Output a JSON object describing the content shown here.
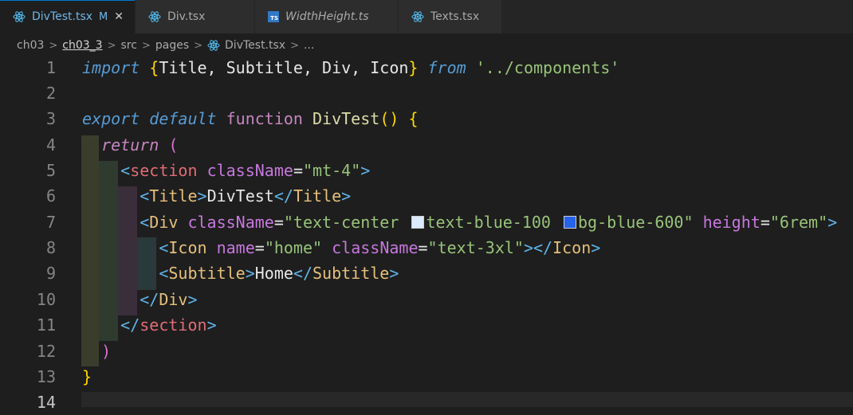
{
  "tabs": [
    {
      "label": "DivTest.tsx",
      "badge": "M",
      "close": "✕",
      "icon": "react-icon",
      "active": true
    },
    {
      "label": "Div.tsx",
      "icon": "react-icon"
    },
    {
      "label": "WidthHeight.ts",
      "icon": "ts-icon",
      "icon_text": "TS"
    },
    {
      "label": "Texts.tsx",
      "icon": "react-icon"
    }
  ],
  "breadcrumb": {
    "items": [
      "ch03",
      "ch03_3",
      "src",
      "pages",
      "DivTest.tsx",
      "..."
    ],
    "separator": ">"
  },
  "editor": {
    "line_numbers": [
      "1",
      "2",
      "3",
      "4",
      "5",
      "6",
      "7",
      "8",
      "9",
      "10",
      "11",
      "12",
      "13",
      "14"
    ],
    "tokens": {
      "import": "import",
      "from": "from",
      "lbrace": "{",
      "rbrace": "}",
      "import_names": "Title, Subtitle, Div, Icon",
      "module": "'../components'",
      "export": "export",
      "default": "default",
      "function": "function",
      "fn_name": "DivTest",
      "parens": "()",
      "return": "return",
      "lparen": "(",
      "rparen": ")",
      "lt": "<",
      "gt": ">",
      "lt_slash": "</",
      "eq": "=",
      "section": "section",
      "title_tag": "Title",
      "div_tag": "Div",
      "icon_tag": "Icon",
      "subtitle_tag": "Subtitle",
      "class_name": "className",
      "name_attr": "name",
      "height_attr": "height",
      "mt4": "\"mt-4\"",
      "divtest_text": "DivTest",
      "div_class_1": "\"text-center ",
      "div_class_2": "text-blue-100 ",
      "div_class_3": "bg-blue-600\"",
      "height_val": "\"6rem\"",
      "home_val": "\"home\"",
      "icon_class": "\"text-3xl\"",
      "home_text": "Home"
    },
    "color_swatches": {
      "text_blue_100": "#dbeafe",
      "bg_blue_600": "#2563eb"
    }
  },
  "colors": {
    "background": "#1e1e1e",
    "tab_active_text": "#6fb6e8",
    "react_icon": "#4fb6e8",
    "ts_icon": "#3178c6",
    "accent": "#0078d4"
  }
}
